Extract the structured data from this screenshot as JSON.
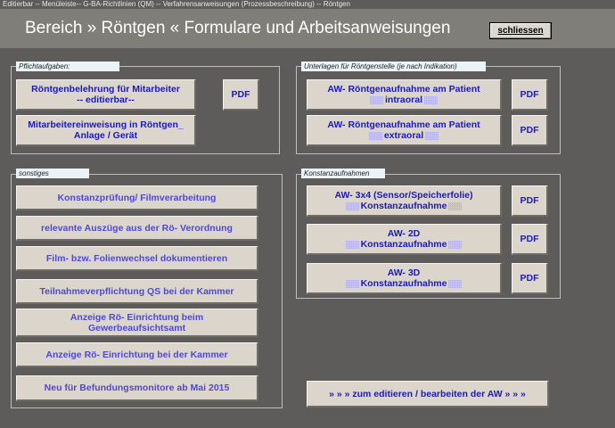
{
  "window": {
    "title": "Editierbar -- Menüleiste-- G-BA-Richtlinien (QM) -- Verfahrensanweisungen (Prozessbeschreibung) -- Röntgen"
  },
  "header": {
    "title": "Bereich » Röntgen « Formulare und Arbeitsanweisungen",
    "close_label": "schliessen"
  },
  "pflicht": {
    "label": "Pflichtaufgaben:",
    "btn1_line1": "Röntgenbelehrung für Mitarbeiter",
    "btn1_line2": "-- editierbar--",
    "btn1_pdf": "PDF",
    "btn2_line1": "Mitarbeitereinweisung in Röntgen_",
    "btn2_line2": "Anlage / Gerät"
  },
  "unterlagen": {
    "label": "Unterlagen für Röntgenstelle (je nach Indikation)",
    "btn1_line1": "AW-  Röntgenaufnahme am Patient",
    "btn1_line2": "intraoral",
    "btn1_pdf": "PDF",
    "btn2_line1": "AW-  Röntgenaufnahme am Patient",
    "btn2_line2": "extraoral",
    "btn2_pdf": "PDF"
  },
  "sonstiges": {
    "label": "sonstiges",
    "items": [
      {
        "line1": "Konstanzprüfung/ Filmverarbeitung",
        "line2": ""
      },
      {
        "line1": "relevante Auszüge aus der Rö- Verordnung",
        "line2": ""
      },
      {
        "line1": "Film- bzw. Folienwechsel dokumentieren",
        "line2": ""
      },
      {
        "line1": "Teilnahmeverpflichtung QS bei der Kammer",
        "line2": ""
      },
      {
        "line1": "Anzeige Rö- Einrichtung beim",
        "line2": "Gewerbeaufsichtsamt"
      },
      {
        "line1": "Anzeige Rö- Einrichtung bei der Kammer",
        "line2": ""
      },
      {
        "line1": "Neu für Befundungsmonitore ab Mai 2015",
        "line2": ""
      }
    ]
  },
  "konstanz": {
    "label": "Konstanzaufnahmen",
    "btn1_line1": "AW-  3x4 (Sensor/Speicherfolie)",
    "btn1_line2": "Konstanzaufnahme",
    "btn1_pdf": "PDF",
    "btn2_line1": "AW-  2D",
    "btn2_line2": "Konstanzaufnahme",
    "btn2_pdf": "PDF",
    "btn3_line1": "AW-  3D",
    "btn3_line2": "Konstanzaufnahme",
    "btn3_pdf": "PDF"
  },
  "edit_button": {
    "label": "» » »  zum editieren / bearbeiten der AW  » » »"
  }
}
